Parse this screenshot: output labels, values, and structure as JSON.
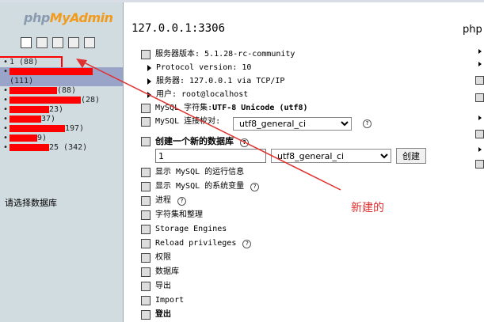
{
  "brand": {
    "prefix": "php",
    "highlight": "MyAdmin"
  },
  "sidebar": {
    "icons": [
      "home-icon",
      "sql-query-icon",
      "sql-icon",
      "docs-icon",
      "help-icon"
    ],
    "databases": [
      {
        "label": "1 (88)",
        "redacted": false,
        "selected": false
      },
      {
        "label": "(111)",
        "redacted": true,
        "selected": true
      },
      {
        "label": "(88)",
        "redacted": true,
        "selected": false
      },
      {
        "label": "(28)",
        "redacted": true,
        "selected": false
      },
      {
        "label": "23)",
        "redacted": true,
        "selected": false
      },
      {
        "label": "37)",
        "redacted": true,
        "selected": false
      },
      {
        "label": "197)",
        "redacted": true,
        "selected": false
      },
      {
        "label": "9)",
        "redacted": true,
        "selected": false
      },
      {
        "label": "25 (342)",
        "redacted": true,
        "selected": false
      }
    ],
    "prompt": "请选择数据库"
  },
  "main": {
    "server_title": "127.0.0.1:3306",
    "right_header": "php",
    "server_version": "服务器版本: 5.1.28-rc-community",
    "protocol": "Protocol version: 10",
    "server": "服务器: 127.0.0.1 via TCP/IP",
    "user": "用户: root@localhost",
    "charset_label": "MySQL 字符集: ",
    "charset_value": "UTF-8 Unicode (utf8)",
    "collation_label": "MySQL 连接校对:",
    "collation_value": "utf8_general_ci",
    "create_db_label": "创建一个新的数据库",
    "new_db_name": "1",
    "new_db_collation": "utf8_general_ci",
    "create_button": "创建",
    "links": [
      "显示 MySQL 的运行信息",
      "显示 MySQL 的系统变量",
      "进程",
      "字符集和整理",
      "Storage Engines",
      "Reload privileges",
      "权限",
      "数据库",
      "导出",
      "Import",
      "登出"
    ]
  },
  "annotation": {
    "text": "新建的",
    "color": "#e03030"
  }
}
